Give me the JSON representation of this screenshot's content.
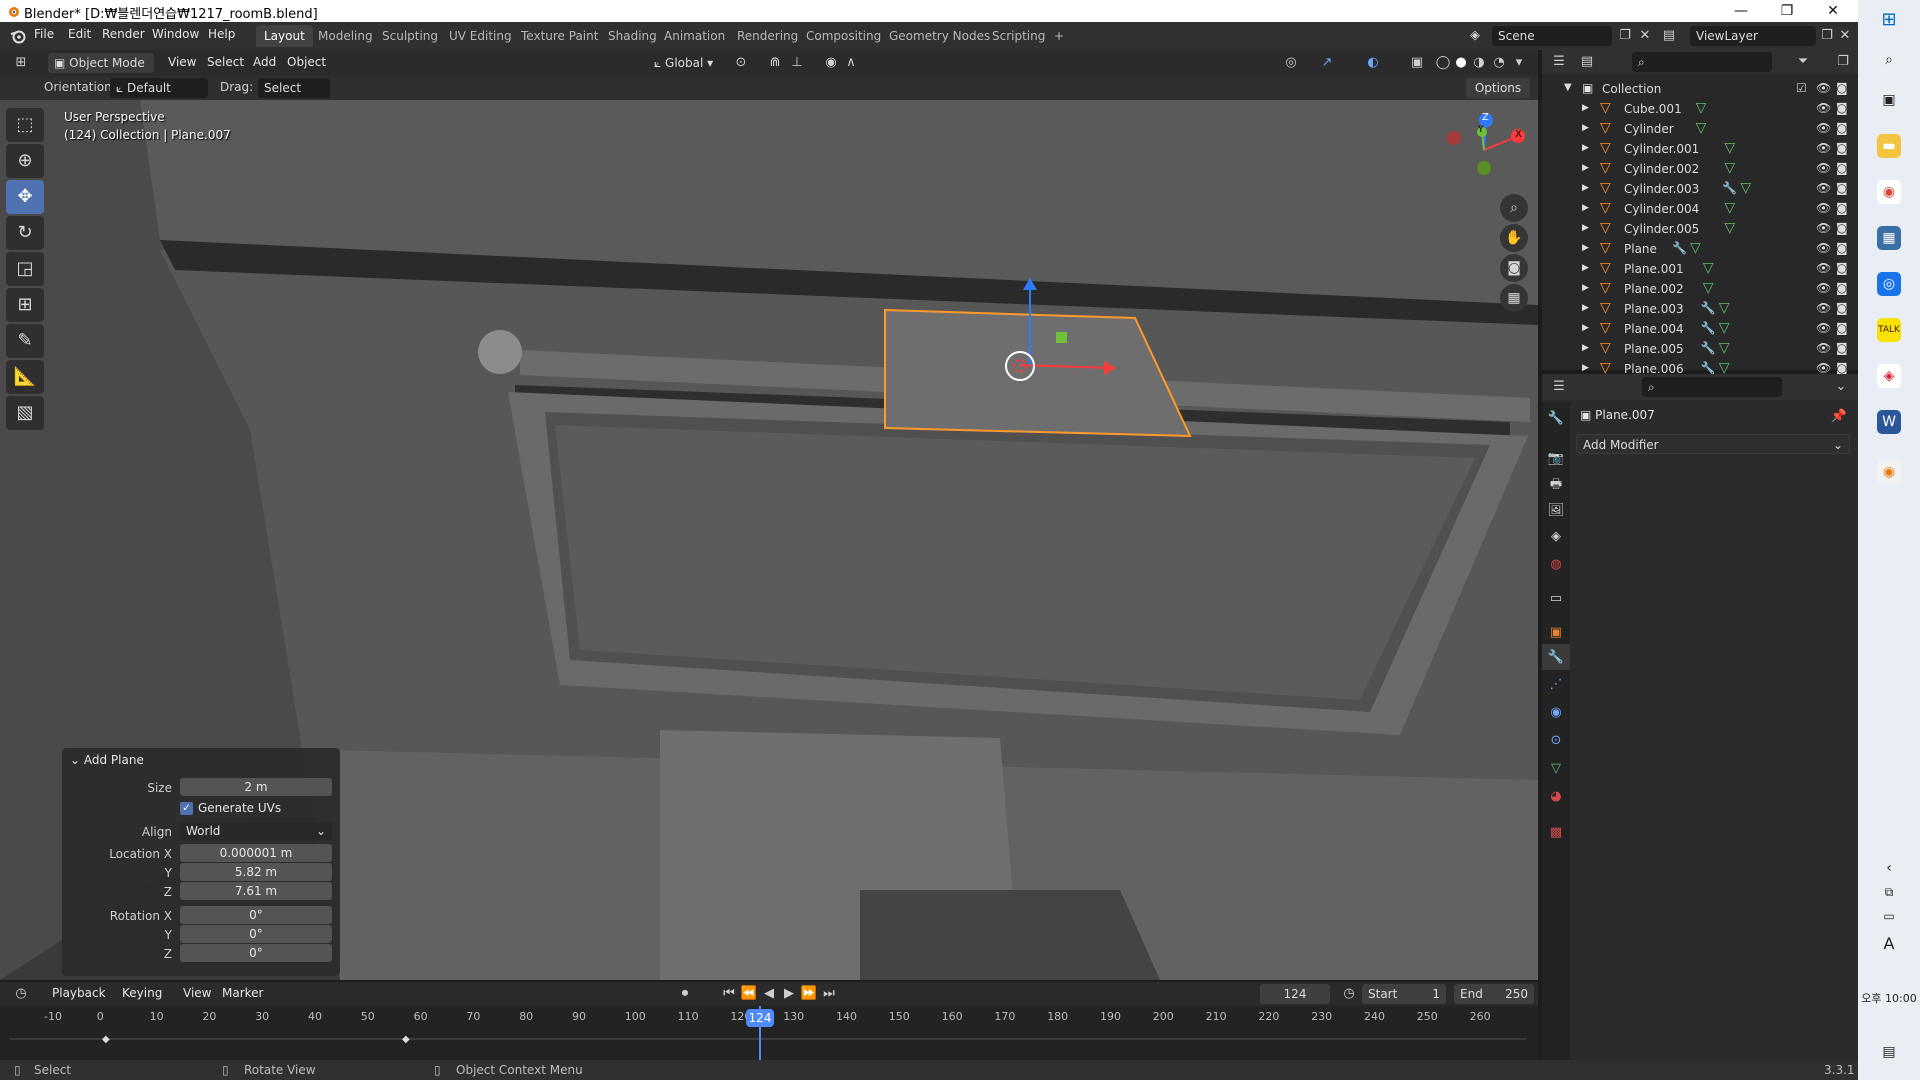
{
  "window": {
    "title": "Blender* [D:₩블렌더연습₩1217_roomB.blend]",
    "min": "—",
    "max": "❐",
    "close": "✕"
  },
  "menus": [
    "File",
    "Edit",
    "Render",
    "Window",
    "Help"
  ],
  "workspaces": [
    "Layout",
    "Modeling",
    "Sculpting",
    "UV Editing",
    "Texture Paint",
    "Shading",
    "Animation",
    "Rendering",
    "Compositing",
    "Geometry Nodes",
    "Scripting",
    "+"
  ],
  "scene": {
    "label": "Scene",
    "view_layer": "ViewLayer"
  },
  "viewport_header": {
    "mode": "Object Mode",
    "menu": [
      "View",
      "Select",
      "Add",
      "Object"
    ],
    "transform": "Global",
    "orientation_label": "Orientation:",
    "orientation": "Default",
    "drag_label": "Drag:",
    "drag": "Select Box",
    "options": "Options"
  },
  "viewport": {
    "perspective": "User Perspective",
    "info": "(124) Collection | Plane.007",
    "gizmo": {
      "z": "Z",
      "y": "Y",
      "x": "X"
    }
  },
  "add_plane": {
    "title": "Add Plane",
    "size_label": "Size",
    "size": "2 m",
    "generate_uvs": "Generate UVs",
    "align_label": "Align",
    "align": "World",
    "loc_x_label": "Location X",
    "loc_x": "0.000001 m",
    "loc_y_label": "Y",
    "loc_y": "5.82 m",
    "loc_z_label": "Z",
    "loc_z": "7.61 m",
    "rot_x_label": "Rotation X",
    "rot_x": "0°",
    "rot_y_label": "Y",
    "rot_y": "0°",
    "rot_z_label": "Z",
    "rot_z": "0°"
  },
  "outliner": {
    "collection": "Collection",
    "items": [
      "Cube.001",
      "Cylinder",
      "Cylinder.001",
      "Cylinder.002",
      "Cylinder.003",
      "Cylinder.004",
      "Cylinder.005",
      "Plane",
      "Plane.001",
      "Plane.002",
      "Plane.003",
      "Plane.004",
      "Plane.005",
      "Plane.006"
    ]
  },
  "properties": {
    "object": "Plane.007",
    "add_modifier": "Add Modifier"
  },
  "timeline": {
    "menus": [
      "Playback",
      "Keying",
      "View",
      "Marker"
    ],
    "current": "124",
    "start_label": "Start",
    "start": "1",
    "end_label": "End",
    "end": "250",
    "ticks": [
      "-10",
      "0",
      "10",
      "20",
      "30",
      "40",
      "50",
      "60",
      "70",
      "80",
      "90",
      "100",
      "110",
      "120",
      "130",
      "140",
      "150",
      "160",
      "170",
      "180",
      "190",
      "200",
      "210",
      "220",
      "230",
      "240",
      "250",
      "260"
    ]
  },
  "status": {
    "select": "Select",
    "rotate": "Rotate View",
    "context": "Object Context Menu",
    "version": "3.3.1"
  },
  "taskbar": {
    "time": "오후 10:00",
    "lang": "A"
  }
}
